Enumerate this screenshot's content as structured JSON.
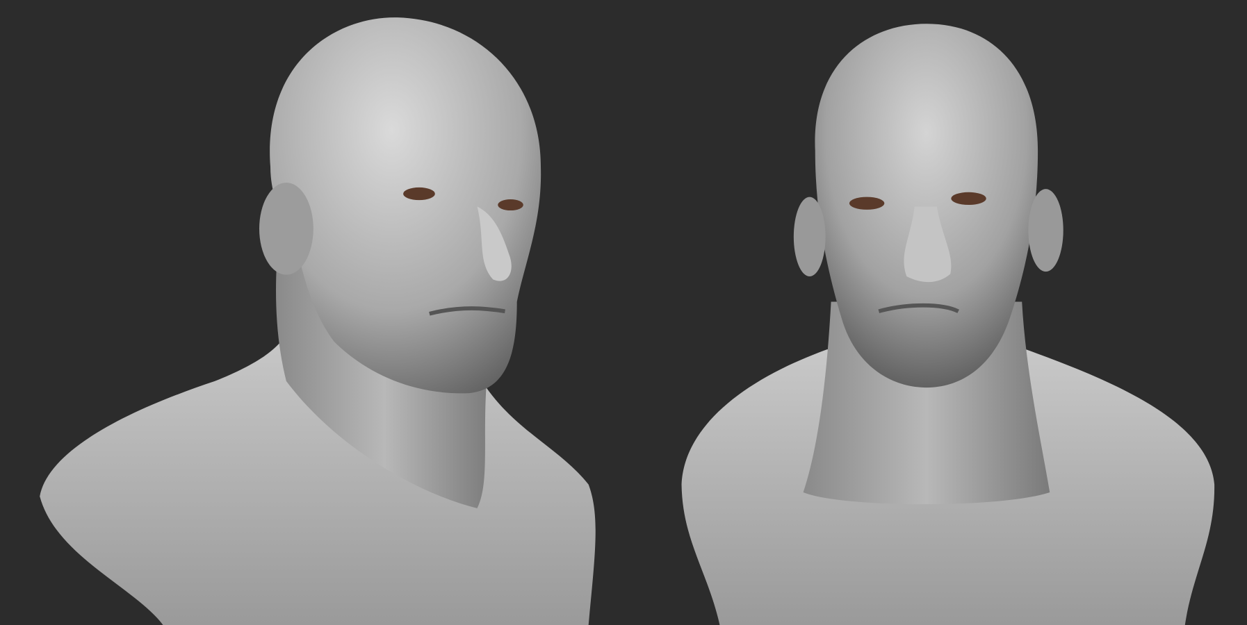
{
  "colors": {
    "background": "#2c2c2c",
    "skin_light": "#d6d6d6",
    "skin_mid": "#a8a8a8",
    "skin_dark": "#5e5e5e",
    "iris": "#5a3a2a"
  },
  "views": [
    {
      "name": "three-quarter-view"
    },
    {
      "name": "front-view"
    }
  ]
}
